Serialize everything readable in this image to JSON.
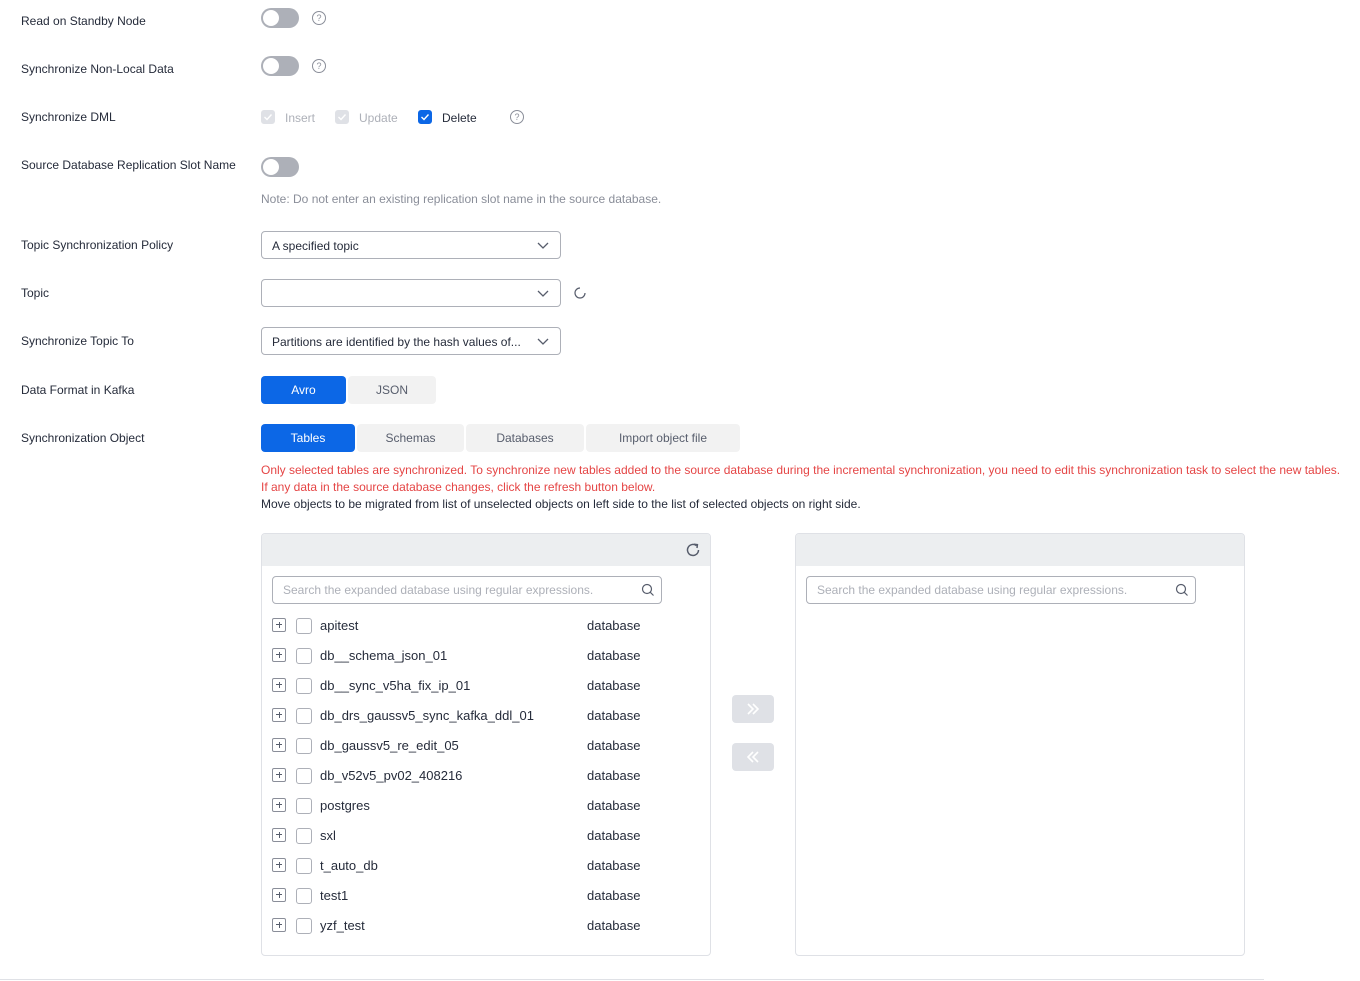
{
  "form": {
    "read_standby": {
      "label": "Read on Standby Node"
    },
    "sync_nonlocal": {
      "label": "Synchronize Non-Local Data"
    },
    "sync_dml": {
      "label": "Synchronize DML",
      "options": [
        {
          "label": "Insert",
          "state": "checked-disabled"
        },
        {
          "label": "Update",
          "state": "checked-disabled"
        },
        {
          "label": "Delete",
          "state": "checked"
        }
      ]
    },
    "replication_slot": {
      "label": "Source Database Replication Slot Name",
      "note": "Note: Do not enter an existing replication slot name in the source database."
    },
    "topic_policy": {
      "label": "Topic Synchronization Policy",
      "value": "A specified topic"
    },
    "topic": {
      "label": "Topic",
      "value": ""
    },
    "sync_topic_to": {
      "label": "Synchronize Topic To",
      "value": "Partitions are identified by the hash values of..."
    },
    "data_format": {
      "label": "Data Format in Kafka",
      "options": [
        "Avro",
        "JSON"
      ],
      "selected": "Avro"
    },
    "sync_object": {
      "label": "Synchronization Object",
      "tabs": [
        "Tables",
        "Schemas",
        "Databases",
        "Import object file"
      ],
      "selected": "Tables",
      "warning_line1": "Only selected tables are synchronized. To synchronize new tables added to the source database during the incremental synchronization, you need to edit this synchronization task to select the new tables.",
      "warning_line2": "If any data in the source database changes, click the refresh button below.",
      "info": "Move objects to be migrated from list of unselected objects on left side to the list of selected objects on right side."
    }
  },
  "left_panel": {
    "search_placeholder": "Search the expanded database using regular expressions.",
    "items": [
      {
        "name": "apitest",
        "type": "database"
      },
      {
        "name": "db__schema_json_01",
        "type": "database"
      },
      {
        "name": "db__sync_v5ha_fix_ip_01",
        "type": "database"
      },
      {
        "name": "db_drs_gaussv5_sync_kafka_ddl_01",
        "type": "database"
      },
      {
        "name": "db_gaussv5_re_edit_05",
        "type": "database"
      },
      {
        "name": "db_v52v5_pv02_408216",
        "type": "database"
      },
      {
        "name": "postgres",
        "type": "database"
      },
      {
        "name": "sxl",
        "type": "database"
      },
      {
        "name": "t_auto_db",
        "type": "database"
      },
      {
        "name": "test1",
        "type": "database"
      },
      {
        "name": "yzf_test",
        "type": "database"
      }
    ]
  },
  "right_panel": {
    "search_placeholder": "Search the expanded database using regular expressions."
  },
  "colors": {
    "primary": "#0c67e6",
    "warning": "#e54545",
    "switch_off": "#adb0b8"
  }
}
